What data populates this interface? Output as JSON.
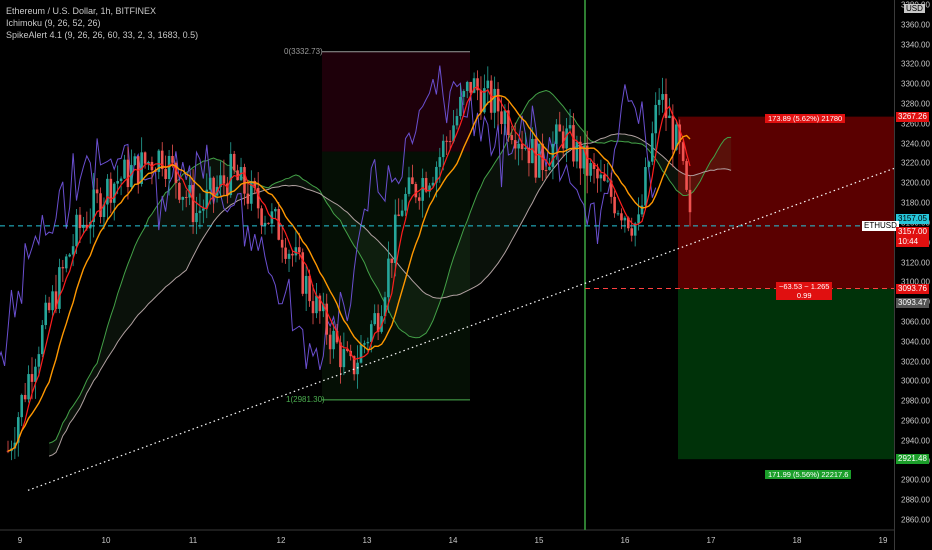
{
  "header": {
    "symbol_line": "Ethereum / U.S. Dollar, 1h, BITFINEX",
    "ichimoku_line": "Ichimoku (9, 26, 52, 26)",
    "spike_line": "SpikeAlert 4.1 (9, 26, 26, 60, 33, 2, 3, 1683, 0.5)"
  },
  "currency": "USD",
  "y_axis": {
    "range": [
      2850,
      3385
    ],
    "ticks": [
      "3380.00",
      "3360.00",
      "3340.00",
      "3320.00",
      "3300.00",
      "3280.00",
      "3260.00",
      "3240.00",
      "3220.00",
      "3200.00",
      "3180.00",
      "3160.00",
      "3140.00",
      "3120.00",
      "3100.00",
      "3080.00",
      "3060.00",
      "3040.00",
      "3020.00",
      "3000.00",
      "2980.00",
      "2960.00",
      "2940.00",
      "2920.00",
      "2900.00",
      "2880.00",
      "2860.00"
    ],
    "tick_values": [
      3380,
      3360,
      3340,
      3320,
      3300,
      3280,
      3260,
      3240,
      3220,
      3200,
      3180,
      3160,
      3140,
      3120,
      3100,
      3080,
      3060,
      3040,
      3020,
      3000,
      2980,
      2960,
      2940,
      2920,
      2900,
      2880,
      2860
    ]
  },
  "x_axis": {
    "ticks": [
      "9",
      "10",
      "11",
      "12",
      "13",
      "14",
      "15",
      "16",
      "17",
      "18",
      "19"
    ]
  },
  "price_tags": {
    "target_top": "3267.26",
    "current_cyan": "3157.05",
    "last_price": "3157.00",
    "last_time": "10:44",
    "entry": "3093.76",
    "stop_gray": "3093.47",
    "target_bottom": "2921.48",
    "symbol_tag": "ETHUSD"
  },
  "labels": {
    "high_label": "0(3332.73)",
    "low_label": "1(2981.30)",
    "profit_box": "173.89 (5.62%) 21780",
    "mid_box_line1": "−63.53 ~ 1.265",
    "mid_box_line2": "0.99",
    "loss_box": "171.99 (5.56%) 22217.6"
  },
  "levels": {
    "fib_high": 3332.73,
    "fib_low": 2981.3,
    "target_top": 3267.26,
    "entry": 3093.76,
    "target_bottom": 2921.48,
    "cyan": 3157.05
  },
  "colors": {
    "up": "#26a69a",
    "down": "#ef5350",
    "tenkan": "#ff1e1e",
    "kijun": "#ff9800",
    "chikou": "#6a4fd0",
    "span_a": "#43a047",
    "span_b": "#b0a0a0",
    "cyan": "#26c6da",
    "green_tag": "#1b9e2a",
    "red_tag": "#e01010"
  }
}
